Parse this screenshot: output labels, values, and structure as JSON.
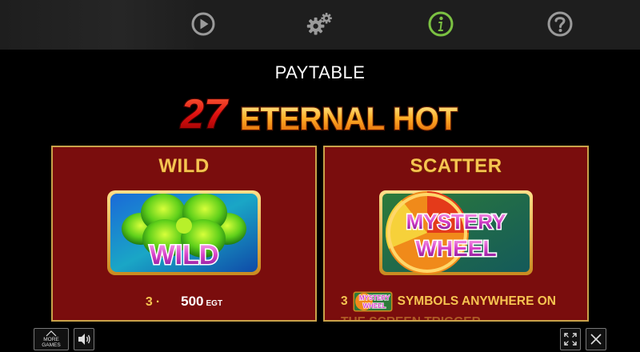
{
  "topbar": {
    "icons": [
      "play-icon",
      "settings-icon",
      "info-icon",
      "help-icon"
    ],
    "active_color": "#7bc142",
    "icon_color": "#9a9a9a"
  },
  "title": "PAYTABLE",
  "logo": {
    "number": "27",
    "text": "ETERNAL HOT"
  },
  "panels": {
    "wild": {
      "title": "WILD",
      "symbol_label": "WILD",
      "pay_count": "3",
      "pay_amount": "500",
      "currency": "EGT"
    },
    "scatter": {
      "title": "SCATTER",
      "symbol_line1": "MYSTERY",
      "symbol_line2": "WHEEL",
      "mini_line1": "MYSTERY",
      "mini_line2": "WHEEL",
      "pay_count": "3",
      "text_line1": "SYMBOLS ANYWHERE ON",
      "text_line2": "THE SCREEN TRIGGER"
    }
  },
  "bottombar": {
    "more_games_line1": "MORE",
    "more_games_line2": "GAMES"
  },
  "colors": {
    "panel_bg": "#7a0d0d",
    "panel_border": "#c9a24a",
    "gold": "#f6c451"
  }
}
